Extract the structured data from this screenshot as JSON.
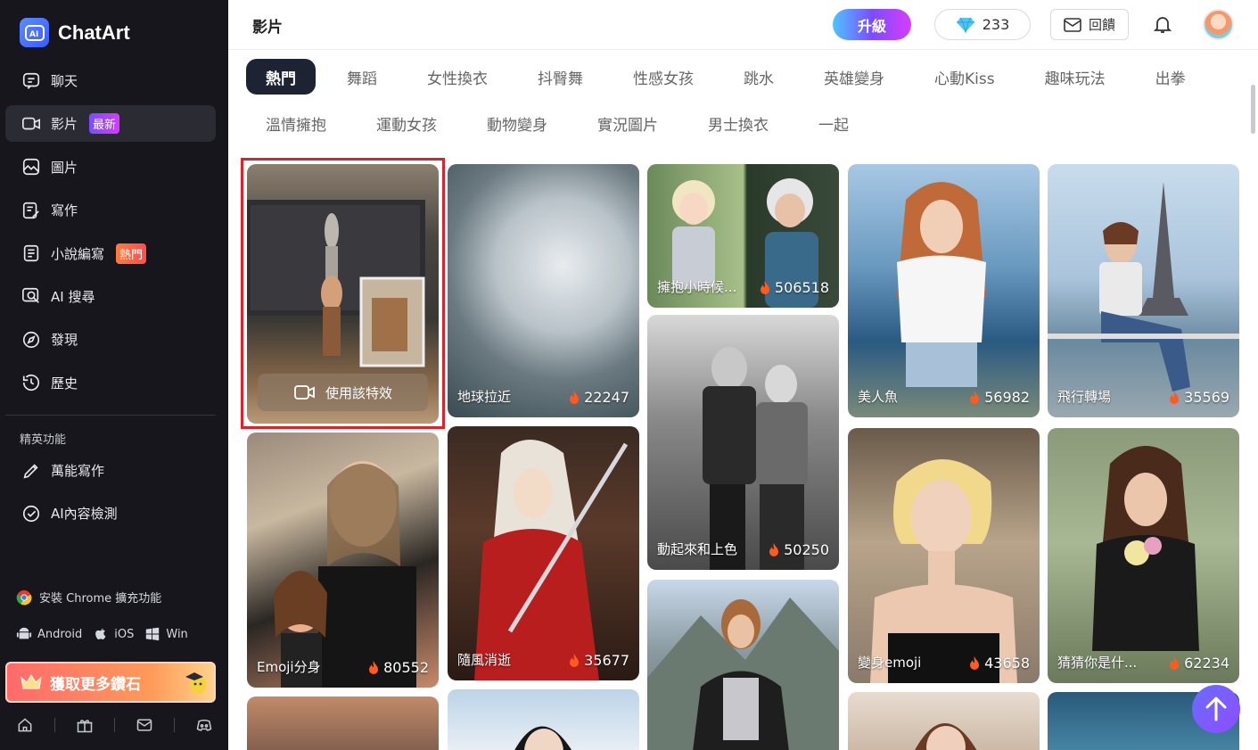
{
  "app": {
    "name": "ChatArt"
  },
  "sidebar": {
    "items": [
      {
        "label": "聊天"
      },
      {
        "label": "影片",
        "badge": "最新"
      },
      {
        "label": "圖片"
      },
      {
        "label": "寫作"
      },
      {
        "label": "小說編寫",
        "badge": "熱門"
      },
      {
        "label": "AI 搜尋"
      },
      {
        "label": "發現"
      },
      {
        "label": "歷史"
      }
    ],
    "section_title": "精英功能",
    "section_items": [
      {
        "label": "萬能寫作"
      },
      {
        "label": "AI內容檢測"
      }
    ],
    "chrome_ext": "安裝 Chrome 擴充功能",
    "platforms": {
      "android": "Android",
      "ios": "iOS",
      "win": "Win"
    },
    "diamond_button": "獲取更多鑽石"
  },
  "header": {
    "title": "影片",
    "upgrade": "升級",
    "gems": "233",
    "feedback": "回饋"
  },
  "tabs": {
    "row1": [
      "熱門",
      "舞蹈",
      "女性換衣",
      "抖臀舞",
      "性感女孩",
      "跳水",
      "英雄變身",
      "心動Kiss",
      "趣味玩法",
      "出拳"
    ],
    "row2": [
      "溫情擁抱",
      "運動女孩",
      "動物變身",
      "實況圖片",
      "男士換衣",
      "一起"
    ],
    "active": "熱門"
  },
  "cards": {
    "c1": {
      "use_label": "使用該特效"
    },
    "c2": {
      "label": "地球拉近",
      "count": "22247"
    },
    "c3": {
      "label": "擁抱小時候...",
      "count": "506518"
    },
    "c4": {
      "label": "美人魚",
      "count": "56982"
    },
    "c5": {
      "label": "飛行轉場",
      "count": "35569"
    },
    "c6": {
      "label": "Emoji分身",
      "count": "80552"
    },
    "c7": {
      "label": "隨風消逝",
      "count": "35677"
    },
    "c8": {
      "label": "動起來和上色",
      "count": "50250"
    },
    "c9": {
      "label": "變身emoji",
      "count": "43658"
    },
    "c10": {
      "label": "猜猜你是什...",
      "count": "62234"
    }
  },
  "colors": {
    "sidebar_bg": "#16161c",
    "active_tab": "#1e2333",
    "highlight": "#e1202a",
    "accent": "#7b4dff"
  }
}
